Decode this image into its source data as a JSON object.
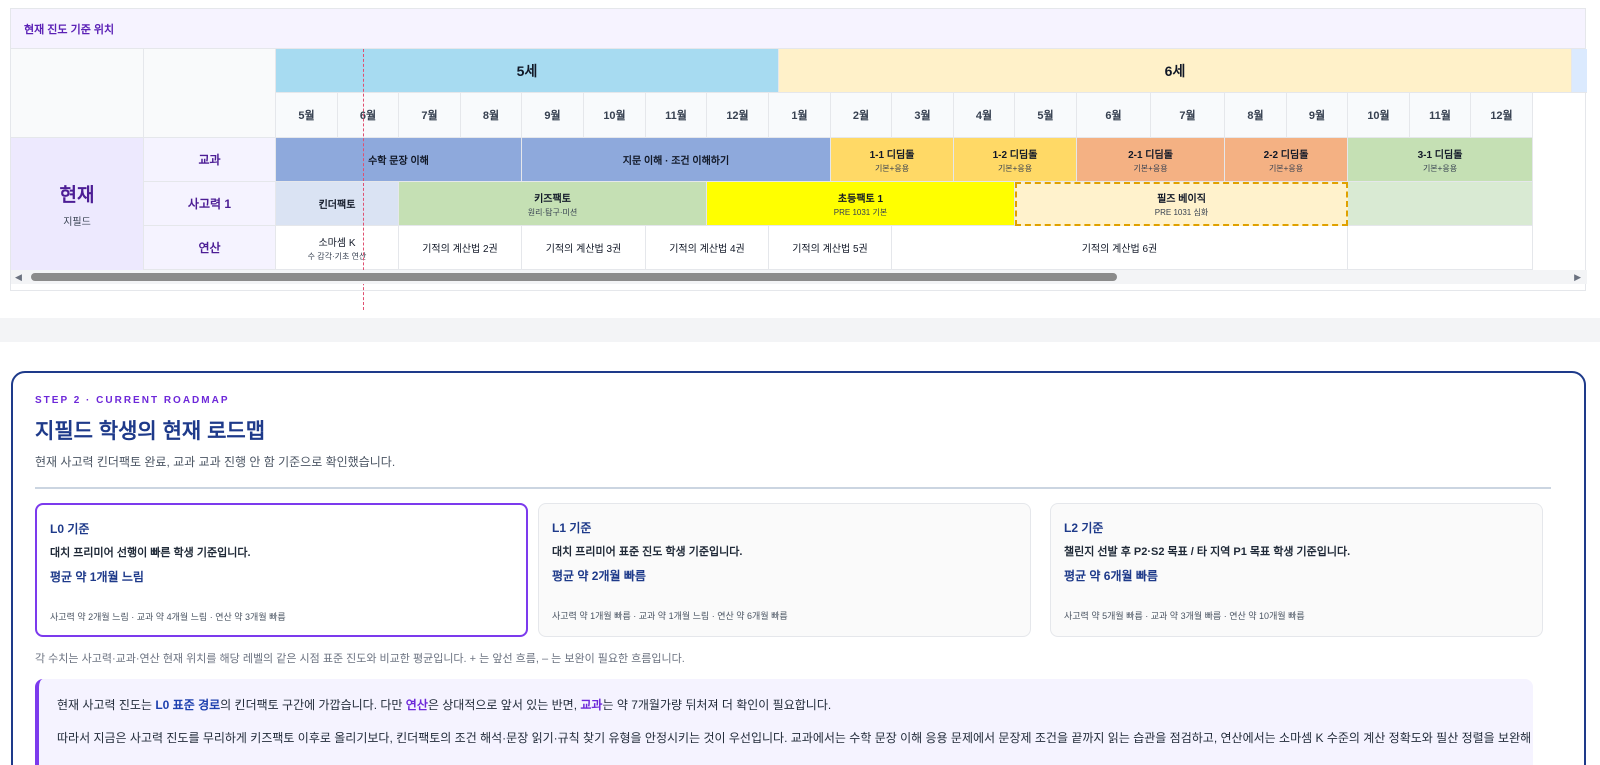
{
  "timeline": {
    "header": "현재 진도 기준 위치",
    "years": [
      "5세",
      "6세"
    ],
    "months": [
      "5월",
      "6월",
      "7월",
      "8월",
      "9월",
      "10월",
      "11월",
      "12월",
      "1월",
      "2월",
      "3월",
      "4월",
      "5월",
      "6월",
      "7월",
      "8월",
      "9월",
      "10월",
      "11월",
      "12월"
    ],
    "student": {
      "name": "현재",
      "id": "지필드"
    },
    "rows": {
      "subject": {
        "label": "교과",
        "bars": [
          {
            "title": "수학 문장 이해",
            "sub": "",
            "color": "#8ea9dc"
          },
          {
            "title": "지문 이해 · 조건 이해하기",
            "sub": "",
            "color": "#8ea9dc"
          },
          {
            "title": "1-1 디딤돌",
            "sub": "기본+응용",
            "color": "#ffd966"
          },
          {
            "title": "1-2 디딤돌",
            "sub": "기본+응용",
            "color": "#ffd966"
          },
          {
            "title": "2-1 디딤돌",
            "sub": "기본+응용",
            "color": "#f4b183"
          },
          {
            "title": "2-2 디딤돌",
            "sub": "기본+응용",
            "color": "#f4b183"
          },
          {
            "title": "3-1 디딤돌",
            "sub": "기본+응용",
            "color": "#c5e0b4"
          }
        ]
      },
      "thinking": {
        "label": "사고력 1",
        "bars": [
          {
            "title": "킨더팩토",
            "sub": "",
            "color": "#dae3f3"
          },
          {
            "title": "키즈팩토",
            "sub": "원리·탐구·미션",
            "color": "#c5e0b4"
          },
          {
            "title": "초등팩토 1",
            "sub": "PRE 1031 기본",
            "color": "#ffff00"
          },
          {
            "title": "필즈 베이직",
            "sub": "PRE 1031 심화",
            "color": "#fff2cc"
          },
          {
            "title": "",
            "sub": "",
            "color": "#d9ead3"
          }
        ]
      },
      "calc": {
        "label": "연산",
        "bars": [
          {
            "title": "소마셈 K",
            "sub": "수 감각·기초 연산"
          },
          {
            "title": "기적의 계산법 2권",
            "sub": ""
          },
          {
            "title": "기적의 계산법 3권",
            "sub": ""
          },
          {
            "title": "기적의 계산법 4권",
            "sub": ""
          },
          {
            "title": "기적의 계산법 5권",
            "sub": ""
          },
          {
            "title": "기적의 계산법 6권",
            "sub": ""
          },
          {
            "title": "",
            "sub": ""
          }
        ]
      }
    }
  },
  "step": {
    "eyebrow": "STEP 2 · CURRENT ROADMAP",
    "title": "지필드 학생의 현재 로드맵",
    "desc": "현재 사고력 킨더팩토 완료, 교과 교과 진행 안 함 기준으로 확인했습니다.",
    "levels": [
      {
        "name": "L0 기준",
        "desc": "대치 프리미어 선행이 빠른 학생 기준입니다.",
        "avg": "평균 약 1개월 느림",
        "detail": "사고력 약 2개월 느림 · 교과 약 4개월 느림 · 연산 약 3개월 빠름"
      },
      {
        "name": "L1 기준",
        "desc": "대치 프리미어 표준 진도 학생 기준입니다.",
        "avg": "평균 약 2개월 빠름",
        "detail": "사고력 약 1개월 빠름 · 교과 약 1개월 느림 · 연산 약 6개월 빠름"
      },
      {
        "name": "L2 기준",
        "desc": "챌린지 선발 후 P2·S2 목표 / 타 지역 P1 목표 학생 기준입니다.",
        "avg": "평균 약 6개월 빠름",
        "detail": "사고력 약 5개월 빠름 · 교과 약 3개월 빠름 · 연산 약 10개월 빠름"
      }
    ],
    "legend_note": "각 수치는 사고력·교과·연산 현재 위치를 해당 레벨의 같은 시점 표준 진도와 비교한 평균입니다. + 는 앞선 흐름, – 는 보완이 필요한 흐름입니다.",
    "summary": {
      "p1": {
        "t1": "현재 사고력 진도는 ",
        "h1": "L0 표준 경로",
        "t2": "의 킨더팩토 구간에 가깝습니다. 다만 ",
        "h2": "연산",
        "t3": "은 상대적으로 앞서 있는 반면, ",
        "h3": "교과",
        "t4": "는 약 7개월가량 뒤처져 더 확인이 필요합니다."
      },
      "p2": "따라서 지금은 사고력 진도를 무리하게 키즈팩토 이후로 올리기보다, 킨더팩토의 조건 해석·문장 읽기·규칙 찾기 유형을 안정시키는 것이 우선입니다. 교과에서는 수학 문장 이해 응용 문제에서 문장제 조건을 끝까지 읽는 습관을 점검하고, 연산에서는 소마셈 K 수준의 계산 정확도와 필산 정렬을 보완해"
    }
  }
}
